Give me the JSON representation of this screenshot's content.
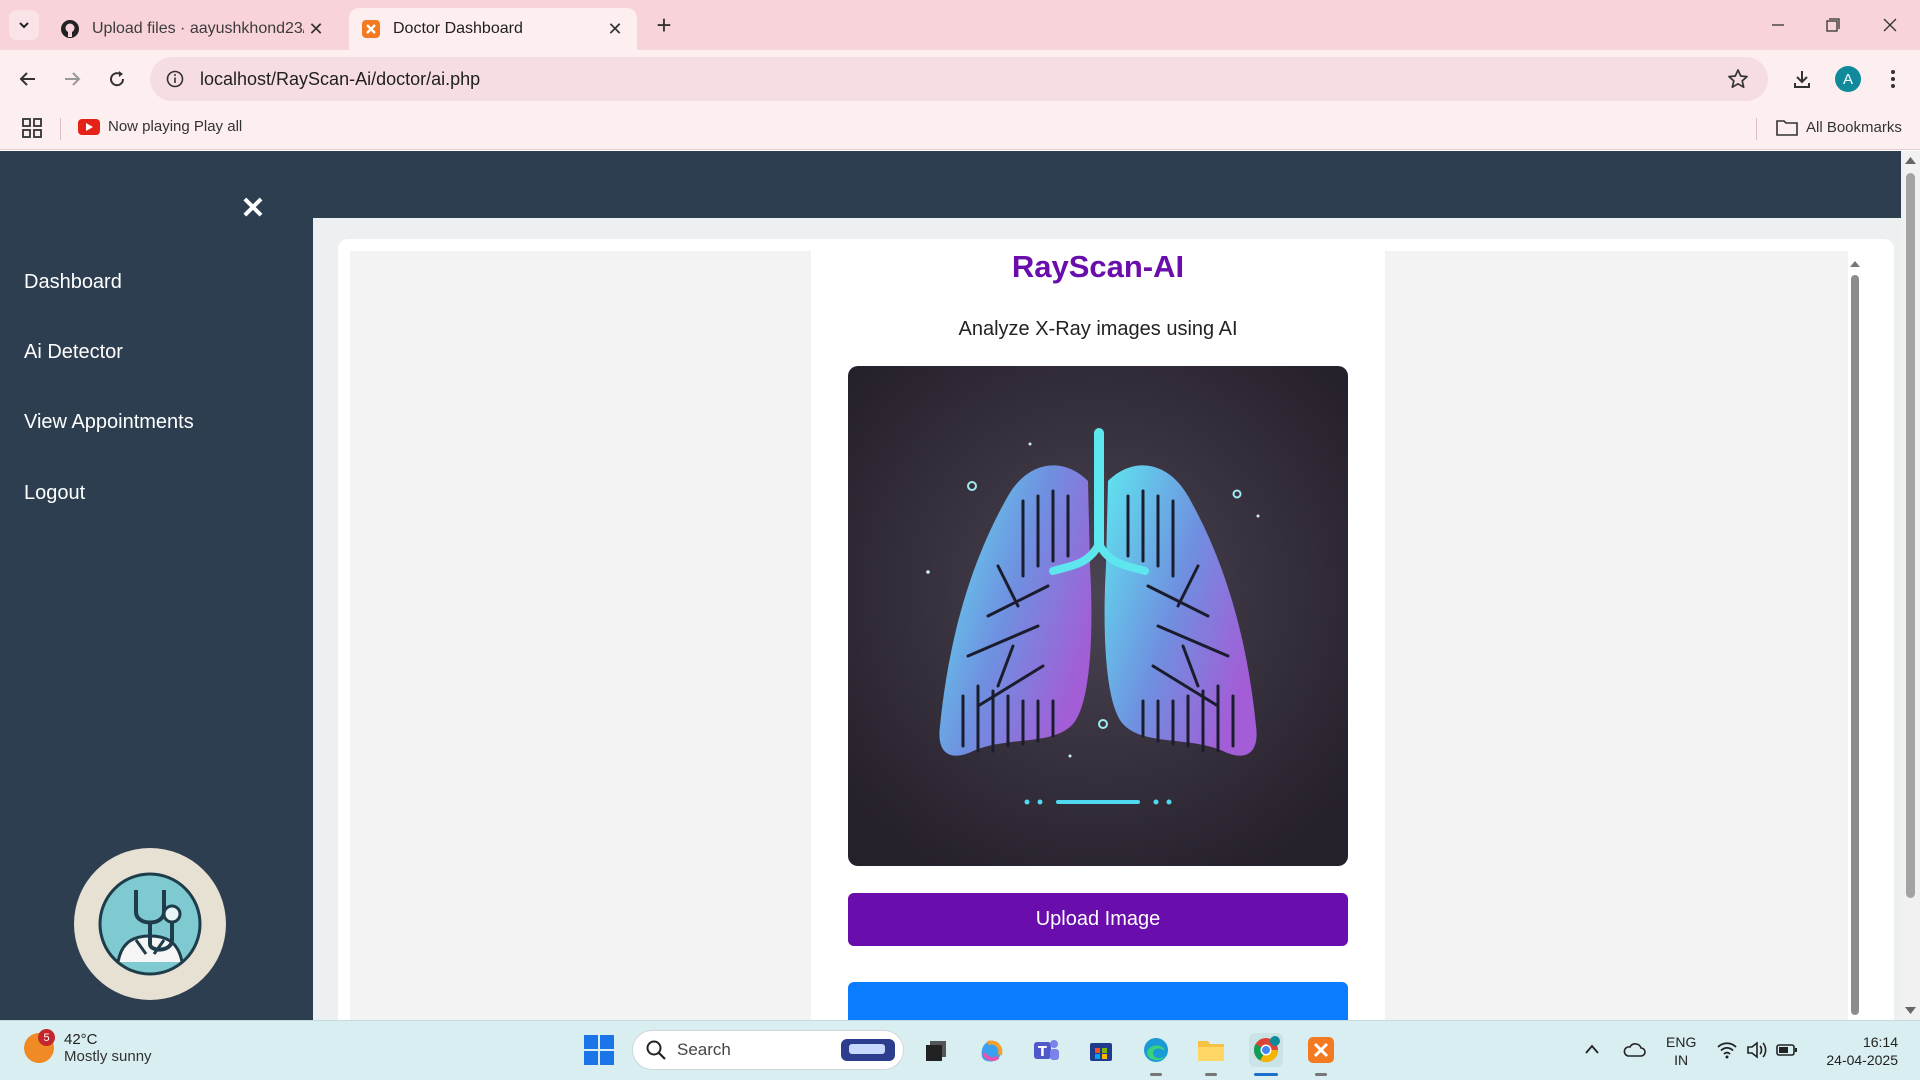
{
  "browser": {
    "tabs": [
      {
        "title": "Upload files · aayushkhond23/p",
        "active": false
      },
      {
        "title": "Doctor Dashboard",
        "active": true
      }
    ],
    "url": "localhost/RayScan-Ai/doctor/ai.php",
    "profile_initial": "A",
    "bookmarks": {
      "now_playing": "Now playing Play all",
      "all_bookmarks": "All Bookmarks"
    }
  },
  "sidebar": {
    "close_symbol": "✕",
    "items": [
      {
        "label": "Dashboard"
      },
      {
        "label": "Ai Detector"
      },
      {
        "label": "View Appointments"
      },
      {
        "label": "Logout"
      }
    ]
  },
  "main": {
    "title": "RayScan-AI",
    "subtitle": "Analyze X-Ray images using AI",
    "upload_button": "Upload Image"
  },
  "taskbar": {
    "weather": {
      "badge": "5",
      "temp": "42°C",
      "condition": "Mostly sunny"
    },
    "search_label": "Search",
    "language": {
      "line1": "ENG",
      "line2": "IN"
    },
    "clock": {
      "time": "16:14",
      "date": "24-04-2025"
    }
  },
  "colors": {
    "sidebar_bg": "#2c3e50",
    "accent_purple": "#6a0dad",
    "accent_blue": "#0a7cff",
    "tab_strip": "#f8d3d9"
  }
}
